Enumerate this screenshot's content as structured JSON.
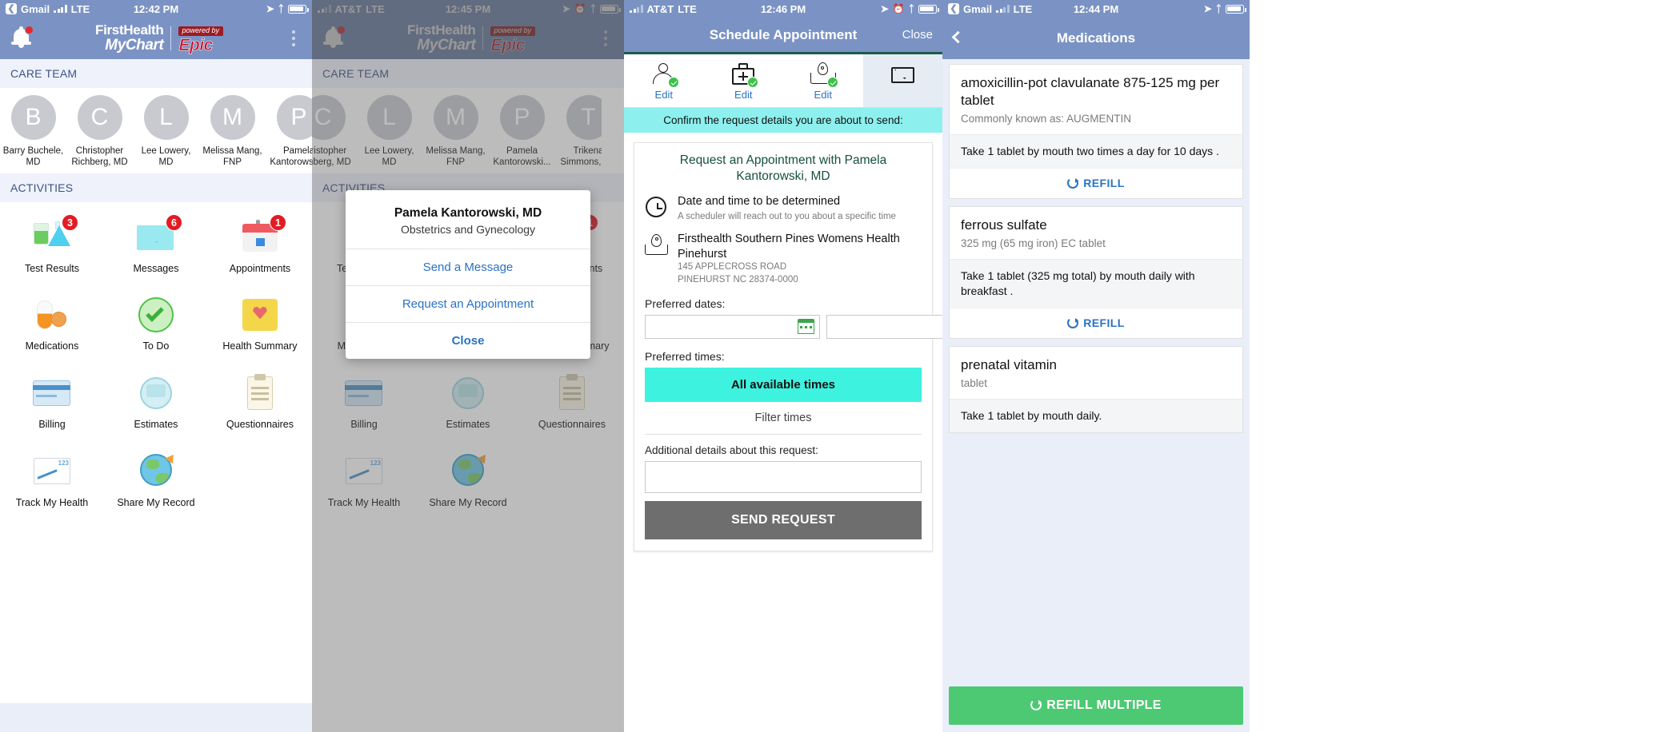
{
  "screens": {
    "s1": {
      "status": {
        "back_app": "Gmail",
        "network": "LTE",
        "time": "12:42 PM"
      },
      "brand": {
        "line1": "FirstHealth",
        "line2": "MyChart",
        "powered": "powered by",
        "epic": "Epic"
      },
      "care_team_header": "CARE TEAM",
      "care_team": [
        {
          "initial": "B",
          "name": "Barry Buchele, MD"
        },
        {
          "initial": "C",
          "name": "Christopher Richberg, MD"
        },
        {
          "initial": "L",
          "name": "Lee Lowery, MD"
        },
        {
          "initial": "M",
          "name": "Melissa Mang, FNP"
        },
        {
          "initial": "P",
          "name": "Pamela Kantorowski..."
        }
      ],
      "activities_header": "ACTIVITIES",
      "activities": [
        {
          "label": "Test Results",
          "badge": "3",
          "icon": "lab-flask-icon"
        },
        {
          "label": "Messages",
          "badge": "6",
          "icon": "envelope-icon"
        },
        {
          "label": "Appointments",
          "badge": "1",
          "icon": "calendar-icon"
        },
        {
          "label": "Medications",
          "badge": "",
          "icon": "pill-icon"
        },
        {
          "label": "To Do",
          "badge": "",
          "icon": "green-check-icon"
        },
        {
          "label": "Health Summary",
          "badge": "",
          "icon": "heart-folder-icon"
        },
        {
          "label": "Billing",
          "badge": "",
          "icon": "credit-card-icon"
        },
        {
          "label": "Estimates",
          "badge": "",
          "icon": "estimate-icon"
        },
        {
          "label": "Questionnaires",
          "badge": "",
          "icon": "clipboard-icon"
        },
        {
          "label": "Track My Health",
          "badge": "",
          "icon": "chart-icon"
        },
        {
          "label": "Share My Record",
          "badge": "",
          "icon": "globe-icon"
        }
      ]
    },
    "s2": {
      "status": {
        "carrier": "AT&T",
        "network": "LTE",
        "time": "12:45 PM"
      },
      "modal": {
        "title": "Pamela Kantorowski, MD",
        "subtitle": "Obstetrics and Gynecology",
        "items": [
          {
            "label": "Send a Message",
            "bold": false
          },
          {
            "label": "Request an Appointment",
            "bold": false
          },
          {
            "label": "Close",
            "bold": true
          }
        ]
      }
    },
    "s3": {
      "status": {
        "carrier": "AT&T",
        "network": "LTE",
        "time": "12:46 PM"
      },
      "nav": {
        "title": "Schedule Appointment",
        "close": "Close"
      },
      "steps": [
        {
          "edit": "Edit",
          "icon": "person-check-icon",
          "selected": false
        },
        {
          "edit": "Edit",
          "icon": "medical-kit-check-icon",
          "selected": false
        },
        {
          "edit": "Edit",
          "icon": "map-pin-check-icon",
          "selected": false
        },
        {
          "edit": "",
          "icon": "envelope-icon",
          "selected": true
        }
      ],
      "confirm_bar": "Confirm the request details you are about to send:",
      "card": {
        "title": "Request an Appointment with Pamela Kantorowski, MD",
        "datetime_title": "Date and time to be determined",
        "datetime_sub": "A scheduler will reach out to you about a specific time",
        "location_title": "Firsthealth Southern Pines Womens Health Pinehurst",
        "location_line1": "145 APPLECROSS ROAD",
        "location_line2": "PINEHURST NC 28374-0000",
        "preferred_dates_label": "Preferred dates:",
        "date_from_value": "",
        "date_to_value": "",
        "preferred_times_label": "Preferred times:",
        "all_times": "All available times",
        "filter_times": "Filter times",
        "details_label": "Additional details about this request:",
        "details_value": "",
        "send_button": "SEND REQUEST"
      }
    },
    "s4": {
      "status": {
        "back_app": "Gmail",
        "network": "LTE",
        "time": "12:44 PM"
      },
      "nav": {
        "title": "Medications"
      },
      "medications": [
        {
          "name": "amoxicillin-pot clavulanate 875-125 mg per tablet",
          "sub": "Commonly known as: AUGMENTIN",
          "directions": "Take 1 tablet by mouth two times a day   for 10 days .",
          "refill": "REFILL"
        },
        {
          "name": "ferrous sulfate",
          "sub": "325 mg (65 mg iron) EC tablet",
          "directions": "Take 1 tablet (325 mg total) by mouth daily with breakfast  .",
          "refill": "REFILL"
        },
        {
          "name": "prenatal vitamin",
          "sub": "tablet",
          "directions": "Take 1 tablet by mouth daily.",
          "refill": ""
        }
      ],
      "refill_multiple": "REFILL MULTIPLE"
    }
  },
  "colors": {
    "nav_blue": "#7b93c4",
    "section_bg": "#eff2fa",
    "badge_red": "#e31b23",
    "link_blue": "#2a72c4",
    "teal": "#8df0ee",
    "cyan_button": "#3ef2e0",
    "green_button": "#4cc972",
    "dark_green": "#15503f",
    "gray_button": "#6e6e6e"
  }
}
